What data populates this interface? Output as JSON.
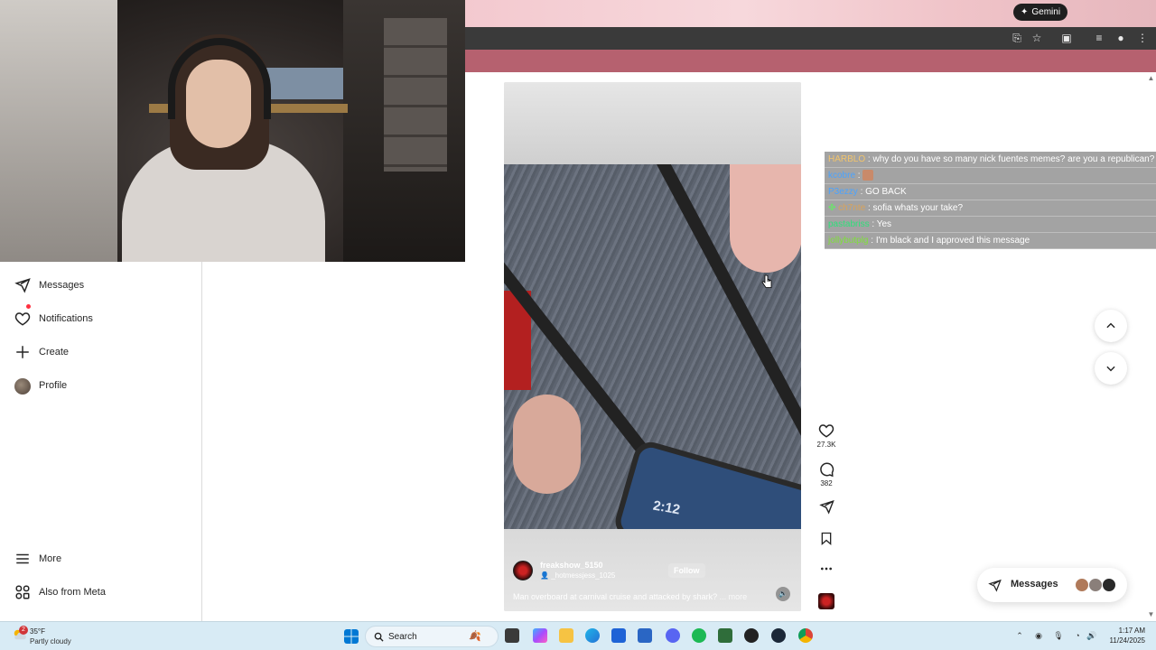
{
  "browser": {
    "gemini_label": "Gemini"
  },
  "sidebar": {
    "items": [
      {
        "label": "Messages",
        "icon": "paper-plane-icon"
      },
      {
        "label": "Notifications",
        "icon": "heart-icon"
      },
      {
        "label": "Create",
        "icon": "plus-icon"
      },
      {
        "label": "Profile",
        "icon": "avatar"
      }
    ],
    "bottom_items": [
      {
        "label": "More",
        "icon": "hamburger-icon"
      },
      {
        "label": "Also from Meta",
        "icon": "meta-grid-icon"
      }
    ]
  },
  "reel": {
    "username": "freakshow_5150",
    "collaborator": "_hotmessjess_1025",
    "follow_label": "Follow",
    "caption": "Man overboard at carnival cruise and attacked by shark?",
    "more_label": "... more",
    "phone_time": "2:12",
    "likes": "27.3K",
    "comments": "382"
  },
  "chat": {
    "messages": [
      {
        "user": "HARBLO",
        "user_color": "#f2c46b",
        "text": "why do you have so many nick fuentes memes? are you a republican?"
      },
      {
        "user": "kcobre",
        "user_color": "#4aa3ff",
        "text": ""
      },
      {
        "user": "P3ezzy",
        "user_color": "#4aa3ff",
        "text": "GO BACK"
      },
      {
        "user": "ch7nte",
        "user_color": "#d9a35b",
        "text": "sofia whats your take?"
      },
      {
        "user": "pastabriss",
        "user_color": "#2ee07a",
        "text": "Yes"
      },
      {
        "user": "jollybutplg",
        "user_color": "#7fe03a",
        "text": "I'm black and I approved this message"
      }
    ]
  },
  "messages_pill": {
    "label": "Messages"
  },
  "taskbar": {
    "weather_badge": "2",
    "temperature": "35°F",
    "condition": "Partly cloudy",
    "search_label": "Search",
    "time": "1:17 AM",
    "date": "11/24/2025"
  }
}
